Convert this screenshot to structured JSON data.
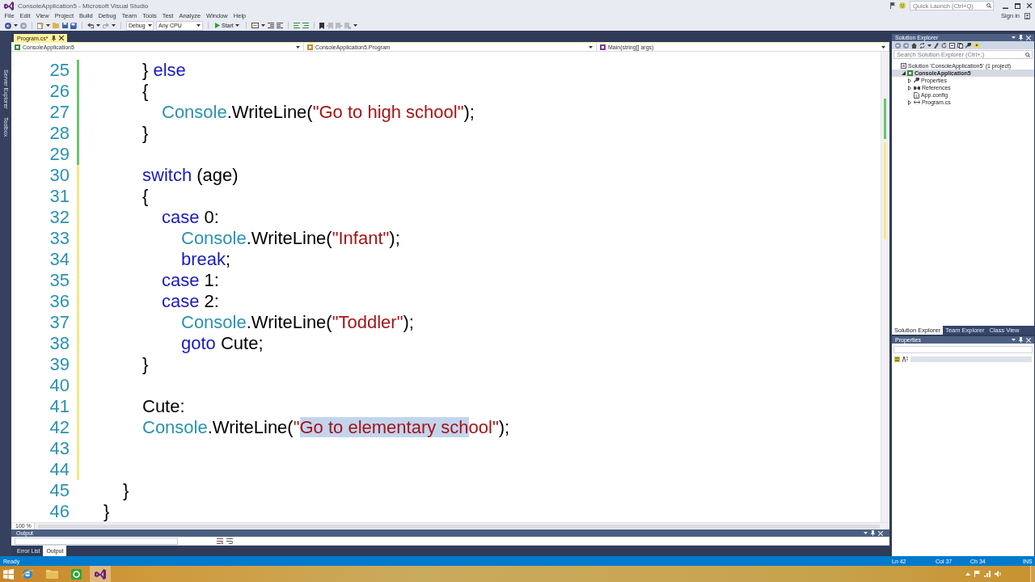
{
  "window": {
    "title": "ConsoleApplication5 - Microsoft Visual Studio",
    "quick_launch": {
      "placeholder": "Quick Launch (Ctrl+Q)"
    }
  },
  "menu": {
    "items": [
      "File",
      "Edit",
      "View",
      "Project",
      "Build",
      "Debug",
      "Team",
      "Tools",
      "Test",
      "Analyze",
      "Window",
      "Help"
    ],
    "sign_in": "Sign in"
  },
  "toolbar": {
    "configuration": "Debug",
    "platform": "Any CPU",
    "start": "Start"
  },
  "side_tabs": [
    "Server Explorer",
    "Toolbox"
  ],
  "document_tabs": [
    {
      "label": "Program.cs*",
      "selected": true
    }
  ],
  "navigation_bar": {
    "project": "ConsoleApplication5",
    "type": "ConsoleApplication5.Program",
    "member": "Main(string[] args)"
  },
  "editor": {
    "lines": [
      {
        "number": "25",
        "change_marker": {
          "color": "#6cc26c"
        },
        "tokens": [
          {
            "kind": "plain",
            "text": "\t\t\t} "
          },
          {
            "kind": "keyword",
            "text": "else"
          }
        ]
      },
      {
        "number": "26",
        "change_marker": {
          "color": "#6cc26c"
        },
        "tokens": [
          {
            "kind": "plain",
            "text": "\t\t\t{"
          }
        ]
      },
      {
        "number": "27",
        "change_marker": {
          "color": "#6cc26c"
        },
        "tokens": [
          {
            "kind": "type",
            "text": "\t\t\t\tConsole"
          },
          {
            "kind": "plain",
            "text": ".WriteLine("
          },
          {
            "kind": "string",
            "text": "\"Go to high school\""
          },
          {
            "kind": "plain",
            "text": ");"
          }
        ]
      },
      {
        "number": "28",
        "change_marker": {
          "color": "#6cc26c"
        },
        "tokens": [
          {
            "kind": "plain",
            "text": "\t\t\t}"
          }
        ]
      },
      {
        "number": "29",
        "change_marker": {
          "color": "#6cc26c"
        }
      },
      {
        "number": "30",
        "change_marker": {
          "color": "#f2e98a"
        },
        "tokens": [
          {
            "kind": "keyword",
            "text": "\t\t\tswitch"
          },
          {
            "kind": "plain",
            "text": " (age)"
          }
        ]
      },
      {
        "number": "31",
        "change_marker": {
          "color": "#f2e98a"
        },
        "tokens": [
          {
            "kind": "plain",
            "text": "\t\t\t{"
          }
        ]
      },
      {
        "number": "32",
        "change_marker": {
          "color": "#f2e98a"
        },
        "tokens": [
          {
            "kind": "keyword",
            "text": "\t\t\t\tcase"
          },
          {
            "kind": "plain",
            "text": " 0:"
          }
        ]
      },
      {
        "number": "33",
        "change_marker": {
          "color": "#f2e98a"
        },
        "tokens": [
          {
            "kind": "type",
            "text": "\t\t\t\t\tConsole"
          },
          {
            "kind": "plain",
            "text": ".WriteLine("
          },
          {
            "kind": "string",
            "text": "\"Infant\""
          },
          {
            "kind": "plain",
            "text": ");"
          }
        ]
      },
      {
        "number": "34",
        "change_marker": {
          "color": "#f2e98a"
        },
        "tokens": [
          {
            "kind": "keyword",
            "text": "\t\t\t\t\tbreak"
          },
          {
            "kind": "plain",
            "text": ";"
          }
        ]
      },
      {
        "number": "35",
        "change_marker": {
          "color": "#f2e98a"
        },
        "tokens": [
          {
            "kind": "keyword",
            "text": "\t\t\t\tcase"
          },
          {
            "kind": "plain",
            "text": " 1:"
          }
        ]
      },
      {
        "number": "36",
        "change_marker": {
          "color": "#f2e98a"
        },
        "tokens": [
          {
            "kind": "keyword",
            "text": "\t\t\t\tcase"
          },
          {
            "kind": "plain",
            "text": " 2:"
          }
        ]
      },
      {
        "number": "37",
        "change_marker": {
          "color": "#f2e98a"
        },
        "tokens": [
          {
            "kind": "type",
            "text": "\t\t\t\t\tConsole"
          },
          {
            "kind": "plain",
            "text": ".WriteLine("
          },
          {
            "kind": "string",
            "text": "\"Toddler\""
          },
          {
            "kind": "plain",
            "text": ");"
          }
        ]
      },
      {
        "number": "38",
        "change_marker": {
          "color": "#f2e98a"
        },
        "tokens": [
          {
            "kind": "keyword",
            "text": "\t\t\t\t\tgoto"
          },
          {
            "kind": "plain",
            "text": " Cute;"
          }
        ]
      },
      {
        "number": "39",
        "change_marker": {
          "color": "#f2e98a"
        },
        "tokens": [
          {
            "kind": "plain",
            "text": "\t\t\t}"
          }
        ]
      },
      {
        "number": "40",
        "change_marker": {
          "color": "#f2e98a"
        }
      },
      {
        "number": "41",
        "change_marker": {
          "color": "#f2e98a"
        },
        "tokens": [
          {
            "kind": "plain",
            "text": "\t\t\tCute:"
          }
        ]
      },
      {
        "number": "42",
        "change_marker": {
          "color": "#f2e98a"
        },
        "tokens": [
          {
            "kind": "type",
            "text": "\t\t\tConsole"
          },
          {
            "kind": "plain",
            "text": ".WriteLine("
          },
          {
            "kind": "string",
            "text": "\""
          },
          {
            "kind": "selection",
            "text": "Go to elementary sch"
          },
          {
            "kind": "string",
            "text": "ool\""
          },
          {
            "kind": "plain",
            "text": ");"
          }
        ]
      },
      {
        "number": "43",
        "change_marker": {
          "color": "#f2e98a"
        }
      },
      {
        "number": "44",
        "change_marker": {
          "color": "#f2e98a"
        }
      },
      {
        "number": "45",
        "tokens": [
          {
            "kind": "plain",
            "text": "\t\t}"
          }
        ]
      },
      {
        "number": "46",
        "tokens": [
          {
            "kind": "plain",
            "text": "\t}"
          }
        ]
      }
    ],
    "zoom": "100 %"
  },
  "output": {
    "title": "Output",
    "tabs": [
      {
        "label": "Error List",
        "selected": false
      },
      {
        "label": "Output",
        "selected": true
      }
    ]
  },
  "solution_explorer": {
    "title": "Solution Explorer",
    "search": {
      "placeholder": "Search Solution Explorer (Ctrl+;)"
    },
    "tree": [
      {
        "label": "Solution 'ConsoleApplication5' (1 project)",
        "kind": "solution",
        "selected": false,
        "children": [
          {
            "label": "ConsoleApplication5",
            "kind": "project",
            "expanded": true,
            "selected": true,
            "children": [
              {
                "label": "Properties",
                "kind": "properties",
                "expanded": false,
                "selected": false
              },
              {
                "label": "References",
                "kind": "references",
                "expanded": false,
                "selected": false
              },
              {
                "label": "App.config",
                "kind": "config",
                "selected": false
              },
              {
                "label": "Program.cs",
                "kind": "code-file",
                "expanded": false,
                "selected": false
              }
            ]
          }
        ]
      }
    ]
  },
  "panel_tabs": [
    {
      "label": "Solution Explorer",
      "selected": true
    },
    {
      "label": "Team Explorer",
      "selected": false
    },
    {
      "label": "Class View",
      "selected": false
    }
  ],
  "properties": {
    "title": "Properties"
  },
  "status_bar": {
    "message": "Ready",
    "line": "Ln 42",
    "column": "Col 37",
    "character": "Ch 34",
    "mode": "INS"
  },
  "taskbar": {
    "apps": [
      {
        "kind": "browser",
        "selected": false
      },
      {
        "kind": "folder",
        "selected": false
      },
      {
        "kind": "recorder",
        "selected": false
      },
      {
        "kind": "visual-studio",
        "selected": true
      }
    ]
  }
}
